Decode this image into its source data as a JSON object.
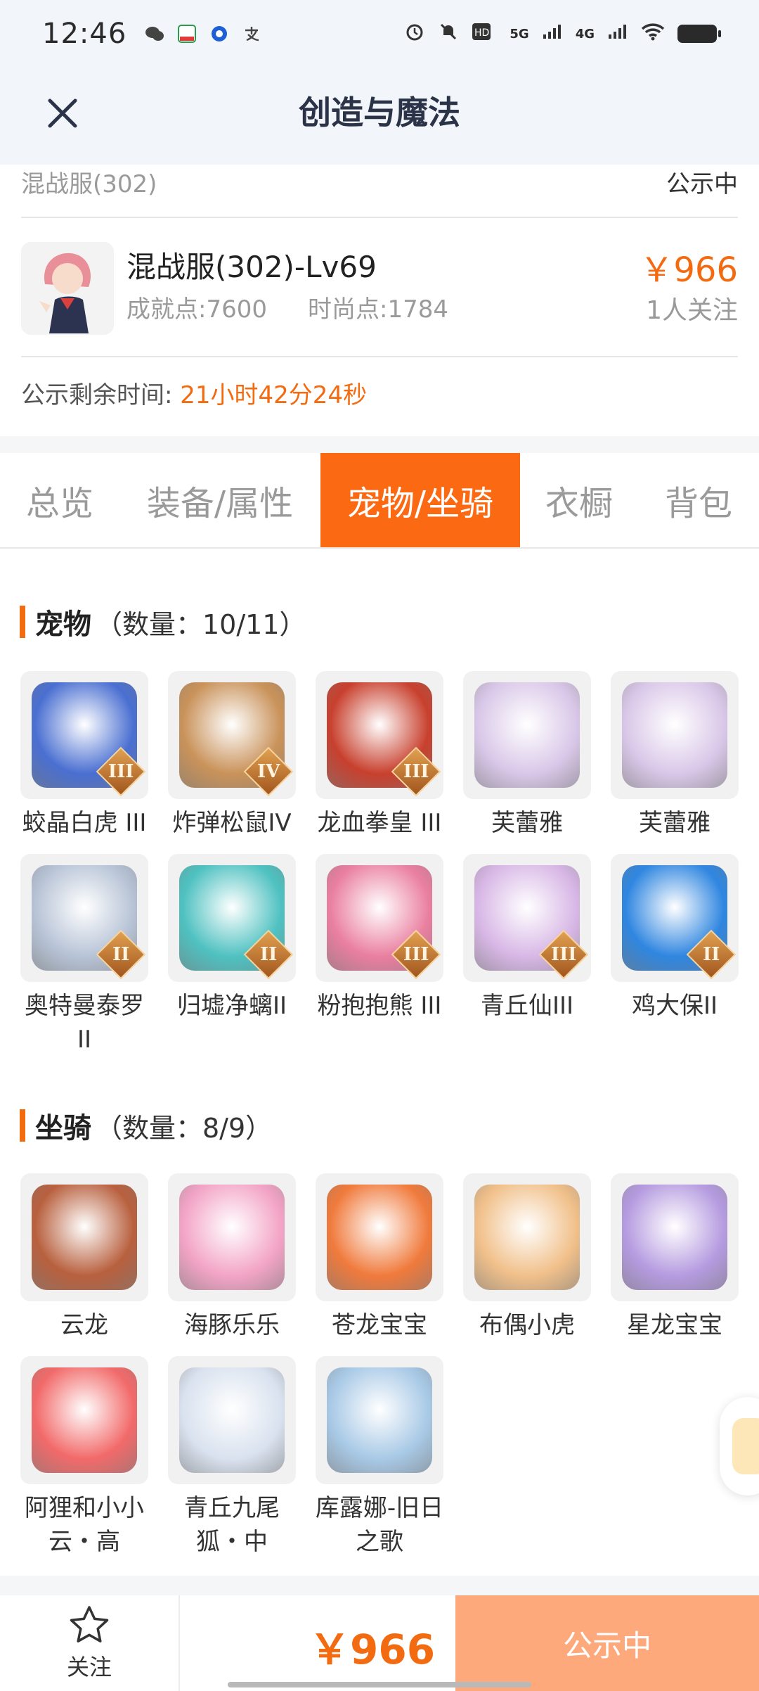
{
  "status_bar": {
    "time": "12:46",
    "network_label_1": "5G",
    "network_label_2": "4G"
  },
  "header": {
    "title": "创造与魔法"
  },
  "summary": {
    "prev_server": "混战服(302)",
    "prev_status": "公示中",
    "item_name": "混战服(302)-Lv69",
    "achievement": "成就点:7600",
    "fashion": "时尚点:1784",
    "price": "￥966",
    "followers": "1人关注",
    "timer_label": "公示剩余时间:",
    "timer_value": "21小时42分24秒"
  },
  "tabs": [
    {
      "label": "总览",
      "active": false
    },
    {
      "label": "装备/属性",
      "active": false
    },
    {
      "label": "宠物/坐骑",
      "active": true
    },
    {
      "label": "衣橱",
      "active": false
    },
    {
      "label": "背包",
      "active": false
    }
  ],
  "pets": {
    "title": "宠物",
    "count": "（数量：10/11）",
    "items": [
      {
        "name": "蛟晶白虎 III",
        "badge": "III",
        "color": "#4a6fd1"
      },
      {
        "name": "炸弹松鼠IV",
        "badge": "IV",
        "color": "#c9925a"
      },
      {
        "name": "龙血拳皇 III",
        "badge": "III",
        "color": "#c8402e"
      },
      {
        "name": "芙蕾雅",
        "badge": "",
        "color": "#d9c7e8"
      },
      {
        "name": "芙蕾雅",
        "badge": "",
        "color": "#d9c7e8"
      },
      {
        "name": "奥特曼泰罗II",
        "badge": "II",
        "color": "#b7c3d6"
      },
      {
        "name": "归墟净螭II",
        "badge": "II",
        "color": "#4fc1c1"
      },
      {
        "name": "粉抱抱熊 III",
        "badge": "III",
        "color": "#ea7fa0"
      },
      {
        "name": "青丘仙III",
        "badge": "III",
        "color": "#d8b7e6"
      },
      {
        "name": "鸡大保II",
        "badge": "II",
        "color": "#2f86e0"
      }
    ]
  },
  "mounts": {
    "title": "坐骑",
    "count": "（数量：8/9）",
    "items": [
      {
        "name": "云龙",
        "color": "#b8603e"
      },
      {
        "name": "海豚乐乐",
        "color": "#f3a4c6"
      },
      {
        "name": "苍龙宝宝",
        "color": "#f07a3c"
      },
      {
        "name": "布偶小虎",
        "color": "#f1c08a"
      },
      {
        "name": "星龙宝宝",
        "color": "#b59be0"
      },
      {
        "name": "阿狸和小小云・高",
        "color": "#f26a6a"
      },
      {
        "name": "青丘九尾狐・中",
        "color": "#d9e2ef"
      },
      {
        "name": "库露娜-旧日之歌",
        "color": "#a8c9e6"
      }
    ]
  },
  "bottom_bar": {
    "follow_label": "关注",
    "price": "￥966",
    "status_button": "公示中"
  }
}
